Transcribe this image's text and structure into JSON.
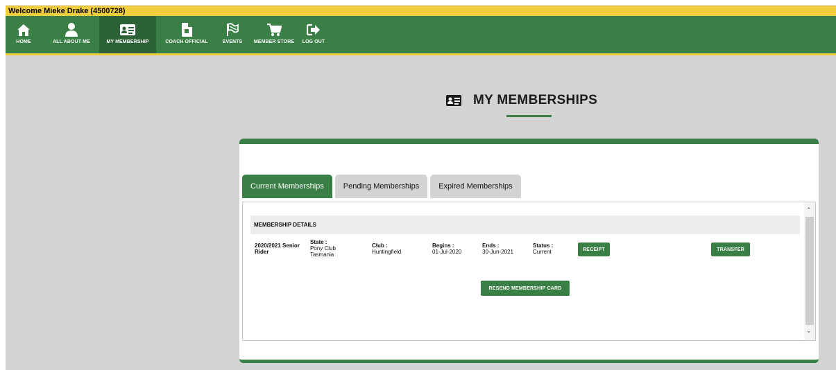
{
  "topbar": {
    "welcome": "Welcome Mieke Drake (4500728)"
  },
  "nav": {
    "items": [
      {
        "label": "HOME",
        "icon": "home-icon"
      },
      {
        "label": "ALL ABOUT ME",
        "icon": "user-icon"
      },
      {
        "label": "MY MEMBERSHIP",
        "icon": "id-card-icon",
        "active": true
      },
      {
        "label": "COACH OFFICIAL",
        "icon": "document-icon"
      },
      {
        "label": "EVENTS",
        "icon": "flag-icon"
      },
      {
        "label": "MEMBER STORE",
        "icon": "cart-icon"
      },
      {
        "label": "LOG OUT",
        "icon": "logout-icon"
      }
    ]
  },
  "page": {
    "title": "MY MEMBERSHIPS",
    "title_icon": "id-card-icon"
  },
  "tabs": [
    {
      "label": "Current Memberships",
      "active": true
    },
    {
      "label": "Pending Memberships",
      "active": false
    },
    {
      "label": "Expired Memberships",
      "active": false
    }
  ],
  "details": {
    "header": "MEMBERSHIP DETAILS",
    "membership": {
      "name_line1": "2020/2021 Senior",
      "name_line2": "Rider",
      "state_label": "State :",
      "state_line1": "Pony Club",
      "state_line2": "Tasmania",
      "club_label": "Club :",
      "club_value": "Huntingfield",
      "begins_label": "Begins :",
      "begins_value": "01-Jul-2020",
      "ends_label": "Ends :",
      "ends_value": "30-Jun-2021",
      "status_label": "Status :",
      "status_value": "Current"
    },
    "receipt_button": "RECEIPT",
    "transfer_button": "TRANSFER",
    "resend_button": "RESEND MEMBERSHIP CARD"
  },
  "colors": {
    "green": "#3a7f45",
    "gold": "#f2cd3d",
    "background": "#d3d3d3"
  }
}
